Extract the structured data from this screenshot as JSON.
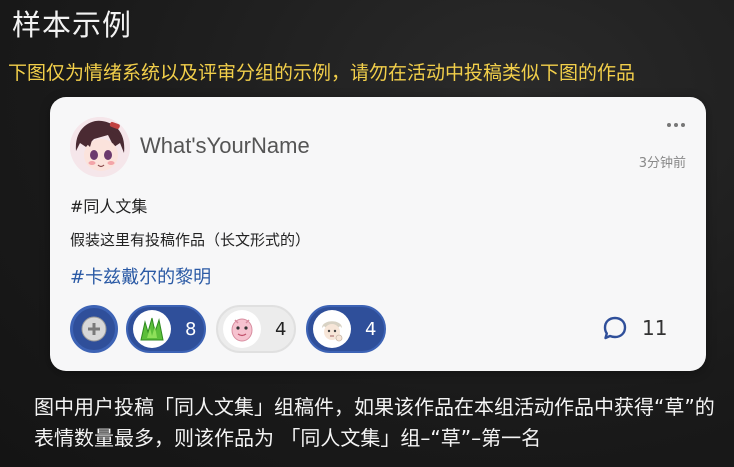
{
  "header": {
    "title": "样本示例",
    "subtitle": "下图仅为情绪系统以及评审分组的示例，请勿在活动中投稿类似下图的作品"
  },
  "post": {
    "username": "What'sYourName",
    "timestamp": "3分钟前",
    "more_icon": "more-dots-icon",
    "tag": "#同人文集",
    "body": "假装这里有投稿作品（长文形式的）",
    "topic": "#卡兹戴尔的黎明",
    "reactions": [
      {
        "icon": "add-reaction-icon"
      },
      {
        "icon": "grass-emoji-icon",
        "count": "8",
        "active": true
      },
      {
        "icon": "pink-creature-emoji-icon",
        "count": "4",
        "active": false
      },
      {
        "icon": "chibi-thinking-emoji-icon",
        "count": "4",
        "active": true
      }
    ],
    "comments": {
      "icon": "comment-bubble-icon",
      "count": "11"
    }
  },
  "caption": {
    "text": "图中用户投稿「同人文集」组稿件，如果该作品在本组活动作品中获得“草”的表情数量最多，则该作品为 「同人文集」组–“草”–第一名"
  },
  "colors": {
    "subtitle": "#f2cf4a",
    "topic_link": "#2b5aa5",
    "active_reaction": "#2f4f9a"
  }
}
